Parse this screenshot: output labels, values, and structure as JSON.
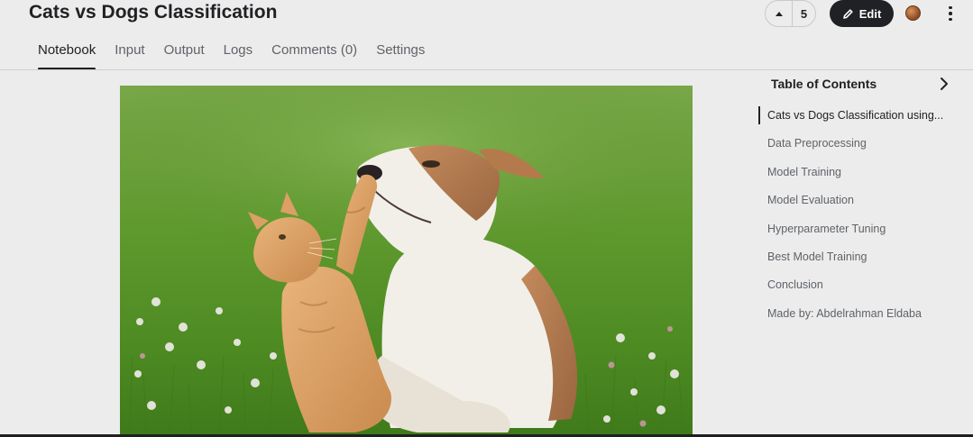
{
  "notebook": {
    "title": "Cats vs Dogs Classification"
  },
  "actions": {
    "vote_count": "5",
    "edit_label": "Edit",
    "upvote_icon": "caret-up-icon",
    "edit_icon": "pencil-icon",
    "more_icon": "vertical-ellipsis-icon"
  },
  "tabs": [
    {
      "label": "Notebook",
      "active": true
    },
    {
      "label": "Input",
      "active": false
    },
    {
      "label": "Output",
      "active": false
    },
    {
      "label": "Logs",
      "active": false
    },
    {
      "label": "Comments (0)",
      "active": false
    },
    {
      "label": "Settings",
      "active": false
    }
  ],
  "toc": {
    "title": "Table of Contents",
    "items": [
      {
        "label": "Cats vs Dogs Classification using...",
        "active": true
      },
      {
        "label": "Data Preprocessing",
        "active": false
      },
      {
        "label": "Model Training",
        "active": false
      },
      {
        "label": "Model Evaluation",
        "active": false
      },
      {
        "label": "Hyperparameter Tuning",
        "active": false
      },
      {
        "label": "Best Model Training",
        "active": false
      },
      {
        "label": "Conclusion",
        "active": false
      },
      {
        "label": "Made by: Abdelrahman Eldaba",
        "active": false
      }
    ]
  },
  "colors": {
    "background": "#ececec",
    "primary_text": "#202124",
    "secondary_text": "#5f6368",
    "edit_button": "#202124"
  }
}
